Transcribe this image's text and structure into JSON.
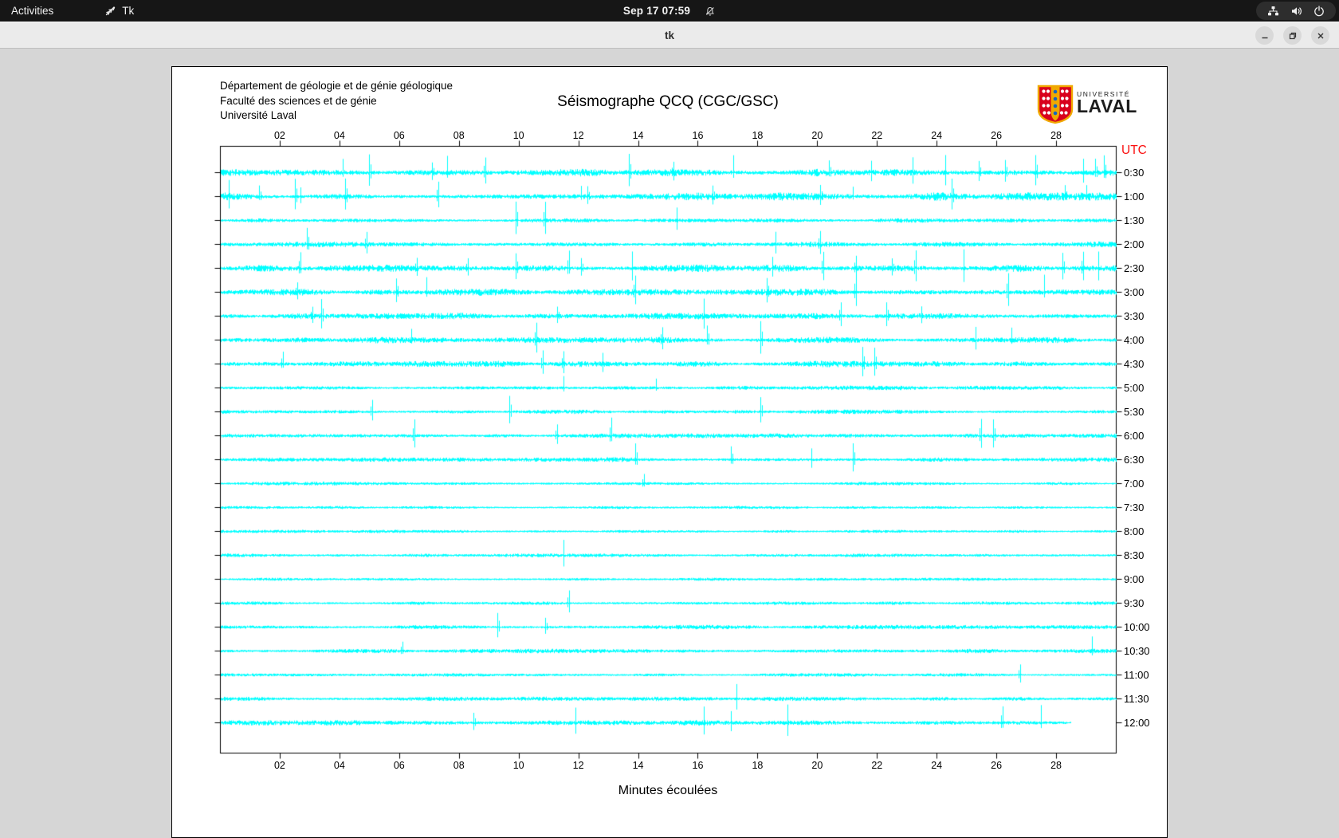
{
  "topbar": {
    "activities": "Activities",
    "app_indicator": "Tk",
    "clock": "Sep 17 07:59"
  },
  "titlebar": {
    "title": "tk"
  },
  "canvas": {
    "header_lines": [
      "Département de géologie et de génie géologique",
      "Faculté des sciences et de génie",
      "Université Laval"
    ],
    "title": "Séismographe QCQ (CGC/GSC)",
    "logo": {
      "line1": "UNIVERSITÉ",
      "line2": "LAVAL"
    },
    "utc_label": "UTC",
    "xlabel": "Minutes écoulées",
    "colors": {
      "trace": "#00ffff",
      "utc": "#fa0f0f",
      "axis": "#000000"
    }
  },
  "chart_data": {
    "type": "line",
    "title": "Séismographe QCQ (CGC/GSC)",
    "xlabel": "Minutes écoulées",
    "x_range": [
      0,
      30
    ],
    "x_ticks": [
      "02",
      "04",
      "06",
      "08",
      "10",
      "12",
      "14",
      "16",
      "18",
      "20",
      "22",
      "24",
      "26",
      "28"
    ],
    "right_axis_title": "UTC",
    "trace_color": "#00ffff",
    "rows": [
      {
        "label": "0:30",
        "amp": 3.2,
        "end": 30,
        "spikes": [
          4.1,
          5.0,
          7.1,
          7.6,
          8.9,
          13.7,
          15.2,
          17.2,
          20.4,
          21.8,
          23.2,
          24.3,
          25.4,
          26.3,
          27.3,
          28.9,
          29.3,
          29.6
        ]
      },
      {
        "label": "1:00",
        "amp": 3.2,
        "end": 30,
        "spikes": [
          0.3,
          1.3,
          2.5,
          2.7,
          4.2,
          7.3,
          12.1,
          12.3,
          16.5,
          20.1,
          21.2,
          24.5,
          28.3,
          29.0
        ]
      },
      {
        "label": "1:30",
        "amp": 1.6,
        "end": 30,
        "spikes": [
          9.9,
          10.9,
          15.3
        ]
      },
      {
        "label": "2:00",
        "amp": 2.2,
        "end": 30,
        "spikes": [
          2.9,
          4.9,
          18.6,
          20.1
        ]
      },
      {
        "label": "2:30",
        "amp": 3.0,
        "end": 30,
        "spikes": [
          2.7,
          6.6,
          8.3,
          9.9,
          11.7,
          12.1,
          13.8,
          18.5,
          20.2,
          21.3,
          22.5,
          23.3,
          24.9,
          28.2,
          28.9,
          29.4
        ]
      },
      {
        "label": "3:00",
        "amp": 2.8,
        "end": 30,
        "spikes": [
          2.6,
          5.9,
          6.9,
          13.9,
          18.3,
          21.3,
          26.4,
          27.6
        ]
      },
      {
        "label": "3:30",
        "amp": 2.4,
        "end": 30,
        "spikes": [
          3.1,
          3.4,
          11.3,
          16.2,
          20.8,
          22.3,
          23.5
        ]
      },
      {
        "label": "4:00",
        "amp": 2.4,
        "end": 30,
        "spikes": [
          6.4,
          10.6,
          14.8,
          16.3,
          18.1,
          25.3,
          26.5
        ]
      },
      {
        "label": "4:30",
        "amp": 2.4,
        "end": 30,
        "spikes": [
          2.1,
          10.8,
          11.5,
          12.8,
          21.5,
          21.9
        ]
      },
      {
        "label": "5:00",
        "amp": 1.6,
        "end": 30,
        "spikes": [
          11.5,
          14.6
        ]
      },
      {
        "label": "5:30",
        "amp": 1.6,
        "end": 30,
        "spikes": [
          5.1,
          9.7,
          18.1
        ]
      },
      {
        "label": "6:00",
        "amp": 1.7,
        "end": 30,
        "spikes": [
          6.5,
          11.3,
          13.1,
          25.5,
          25.9
        ]
      },
      {
        "label": "6:30",
        "amp": 1.7,
        "end": 30,
        "spikes": [
          13.9,
          17.1,
          19.8,
          21.2
        ]
      },
      {
        "label": "7:00",
        "amp": 1.3,
        "end": 30,
        "spikes": [
          14.2
        ]
      },
      {
        "label": "7:30",
        "amp": 1.1,
        "end": 30,
        "spikes": []
      },
      {
        "label": "8:00",
        "amp": 1.1,
        "end": 30,
        "spikes": []
      },
      {
        "label": "8:30",
        "amp": 1.3,
        "end": 30,
        "spikes": [
          11.5
        ]
      },
      {
        "label": "9:00",
        "amp": 1.0,
        "end": 30,
        "spikes": []
      },
      {
        "label": "9:30",
        "amp": 1.3,
        "end": 30,
        "spikes": [
          11.7
        ]
      },
      {
        "label": "10:00",
        "amp": 1.6,
        "end": 30,
        "spikes": [
          9.3,
          10.9
        ]
      },
      {
        "label": "10:30",
        "amp": 1.7,
        "end": 30,
        "spikes": [
          6.1,
          29.2
        ]
      },
      {
        "label": "11:00",
        "amp": 1.2,
        "end": 30,
        "spikes": [
          26.8
        ]
      },
      {
        "label": "11:30",
        "amp": 1.6,
        "end": 30,
        "spikes": [
          17.3
        ]
      },
      {
        "label": "12:00",
        "amp": 2.2,
        "end": 28.5,
        "spikes": [
          8.5,
          11.9,
          16.2,
          17.1,
          19.0,
          26.2,
          27.5
        ]
      }
    ]
  }
}
